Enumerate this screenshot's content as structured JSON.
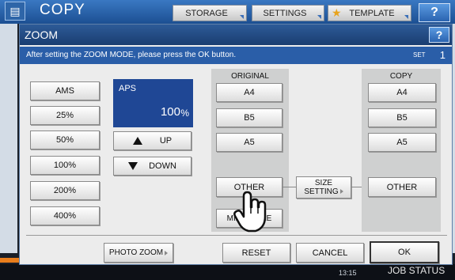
{
  "topbar": {
    "title": "COPY",
    "tabs": {
      "storage": "STORAGE",
      "settings": "SETTINGS",
      "template": "TEMPLATE"
    },
    "help": "?"
  },
  "modal": {
    "title": "ZOOM",
    "help": "?",
    "message": "After setting the ZOOM MODE, please press the OK button.",
    "set_label": "SET",
    "set_count": "1"
  },
  "zoom_buttons": {
    "ams": "AMS",
    "z25": "25%",
    "z50": "50%",
    "z100": "100%",
    "z200": "200%",
    "z400": "400%"
  },
  "aps": {
    "label": "APS",
    "value": "100",
    "unit": "%"
  },
  "adjust": {
    "up": "UP",
    "down": "DOWN"
  },
  "original": {
    "label": "ORIGINAL",
    "a4": "A4",
    "b5": "B5",
    "a5": "A5",
    "other": "OTHER",
    "mixed_size": "MIXED SIZE"
  },
  "size_setting": {
    "line1": "SIZE",
    "line2": "SETTING"
  },
  "copy": {
    "label": "COPY",
    "a4": "A4",
    "b5": "B5",
    "a5": "A5",
    "other": "OTHER"
  },
  "footer": {
    "photo_zoom": "PHOTO ZOOM",
    "reset": "RESET",
    "cancel": "CANCEL",
    "ok": "OK"
  },
  "status": {
    "time": "13:15",
    "job_status": "JOB STATUS"
  }
}
